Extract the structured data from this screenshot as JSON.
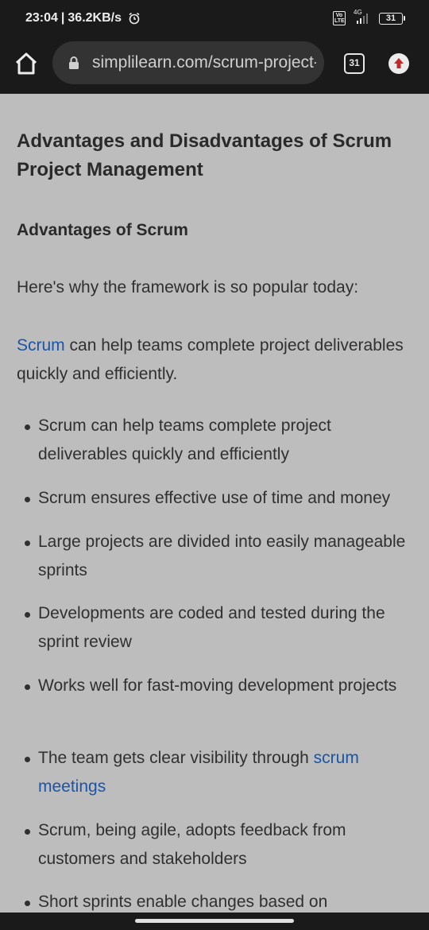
{
  "status_bar": {
    "time": "23:04",
    "separator": "|",
    "speed": "36.2KB/s",
    "volte_label": "Vo LTE",
    "network_label": "4G",
    "battery_level": "31",
    "icons": [
      "alarm-clock-icon",
      "volte-icon",
      "signal-icon",
      "battery-icon"
    ]
  },
  "browser": {
    "url": "simplilearn.com/scrum-project-management",
    "tab_count": "31",
    "icons": [
      "home-icon",
      "lock-icon",
      "tabs-icon",
      "upgrade-icon"
    ]
  },
  "article": {
    "heading": "Advantages and Disadvantages of Scrum Project Management",
    "subheading": "Advantages of Scrum",
    "intro": "Here's why the framework is so popular today:",
    "para_link": "Scrum",
    "para_rest": " can help teams complete project deliverables quickly and efficiently.",
    "bullets": [
      {
        "text": "Scrum can help teams complete project deliverables quickly and efficiently"
      },
      {
        "text": "Scrum ensures effective use of time and money"
      },
      {
        "text": "Large projects are divided into easily manageable sprints"
      },
      {
        "text": "Developments are coded and tested during the sprint review"
      },
      {
        "text": "Works well for fast-moving development projects"
      },
      {
        "text_before": "The team gets clear visibility through ",
        "link": "scrum meetings"
      },
      {
        "text": "Scrum, being agile, adopts feedback from customers and stakeholders"
      },
      {
        "text": "Short sprints enable changes based on"
      }
    ],
    "link_color": "#1b55a8"
  }
}
